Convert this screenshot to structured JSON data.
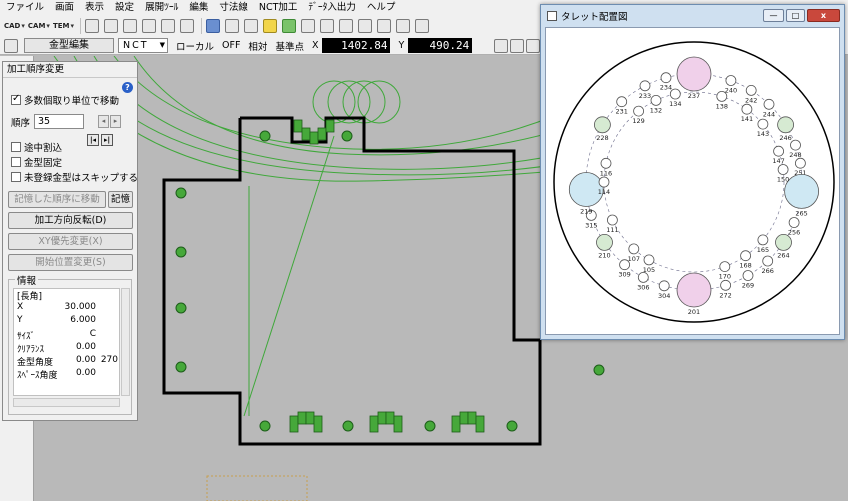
{
  "menubar": {
    "items": [
      "ファイル",
      "画面",
      "表示",
      "設定",
      "展開ﾂｰﾙ",
      "編集",
      "寸法線",
      "NCT加工",
      "ﾃﾞｰﾀ入出力",
      "ヘルプ"
    ]
  },
  "toolbar1": {
    "button_labels": [
      "CAD",
      "CAM",
      "TEM"
    ]
  },
  "toolbar2": {
    "mode_label": "金型編集",
    "mode_select": "NCT",
    "items": [
      "ローカル",
      "OFF",
      "相対",
      "基準点"
    ],
    "x_label": "X",
    "x_value": "1402.84",
    "y_label": "Y",
    "y_value": "490.24"
  },
  "order_panel": {
    "title": "加工順序変更",
    "multi_move": {
      "label": "多数個取り単位で移動",
      "checked": true
    },
    "order_label": "順序",
    "order_value": "35",
    "interrupt": {
      "label": "途中割込",
      "checked": false
    },
    "die_fixed": {
      "label": "金型固定",
      "checked": false
    },
    "skip_unregistered": {
      "label": "未登録金型はスキップする",
      "checked": false
    },
    "move_to_memory_button": "記憶した順序に移動",
    "memory_button": "記憶",
    "reverse_button": "加工方向反転(D)",
    "xy_priority_button": "XY優先変更(X)",
    "start_pos_button": "開始位置変更(S)",
    "info_group_label": "情報",
    "info_rows": [
      {
        "k": "[長角]",
        "v": "",
        "e": ""
      },
      {
        "k": "X",
        "v": "30.000",
        "e": ""
      },
      {
        "k": "Y",
        "v": "6.000",
        "e": ""
      },
      {
        "k": "ｻｲｽﾞ",
        "v": "C",
        "e": ""
      },
      {
        "k": "ｸﾘｱﾗﾝｽ",
        "v": "0.00",
        "e": ""
      },
      {
        "k": "金型角度",
        "v": "0.00",
        "e": "270"
      },
      {
        "k": "ｽﾍﾟｰｽ角度",
        "v": "0.00",
        "e": ""
      }
    ]
  },
  "turret_window": {
    "title": "タレット配置図",
    "stations": [
      {
        "id": "237",
        "ring": "outer",
        "angle": 0,
        "size": "large",
        "fill": "#f0d0ea"
      },
      {
        "id": "240",
        "ring": "outer",
        "angle": 20,
        "size": "small",
        "fill": "#ffffff"
      },
      {
        "id": "242",
        "ring": "outer",
        "angle": 32,
        "size": "small",
        "fill": "#ffffff"
      },
      {
        "id": "244",
        "ring": "outer",
        "angle": 44,
        "size": "small",
        "fill": "#ffffff"
      },
      {
        "id": "246",
        "ring": "outer",
        "angle": 58,
        "size": "medium",
        "fill": "#d6ead2"
      },
      {
        "id": "248",
        "ring": "outer",
        "angle": 70,
        "size": "small",
        "fill": "#ffffff"
      },
      {
        "id": "251",
        "ring": "outer",
        "angle": 80,
        "size": "small",
        "fill": "#ffffff"
      },
      {
        "id": "265",
        "ring": "outer",
        "angle": 95,
        "size": "large",
        "fill": "#cfe8f3"
      },
      {
        "id": "256",
        "ring": "outer",
        "angle": 112,
        "size": "small",
        "fill": "#ffffff"
      },
      {
        "id": "264",
        "ring": "outer",
        "angle": 124,
        "size": "medium",
        "fill": "#d6ead2"
      },
      {
        "id": "266",
        "ring": "outer",
        "angle": 137,
        "size": "small",
        "fill": "#ffffff"
      },
      {
        "id": "269",
        "ring": "outer",
        "angle": 150,
        "size": "small",
        "fill": "#ffffff"
      },
      {
        "id": "272",
        "ring": "outer",
        "angle": 163,
        "size": "small",
        "fill": "#ffffff"
      },
      {
        "id": "201",
        "ring": "outer",
        "angle": 180,
        "size": "large",
        "fill": "#f0d0ea"
      },
      {
        "id": "304",
        "ring": "outer",
        "angle": 196,
        "size": "small",
        "fill": "#ffffff"
      },
      {
        "id": "306",
        "ring": "outer",
        "angle": 208,
        "size": "small",
        "fill": "#ffffff"
      },
      {
        "id": "309",
        "ring": "outer",
        "angle": 220,
        "size": "small",
        "fill": "#ffffff"
      },
      {
        "id": "210",
        "ring": "outer",
        "angle": 236,
        "size": "medium",
        "fill": "#d6ead2"
      },
      {
        "id": "315",
        "ring": "outer",
        "angle": 252,
        "size": "small",
        "fill": "#ffffff"
      },
      {
        "id": "219",
        "ring": "outer",
        "angle": 266,
        "size": "large",
        "fill": "#cfe8f3"
      },
      {
        "id": "228",
        "ring": "outer",
        "angle": 302,
        "size": "medium",
        "fill": "#d6ead2"
      },
      {
        "id": "231",
        "ring": "outer",
        "angle": 318,
        "size": "small",
        "fill": "#ffffff"
      },
      {
        "id": "233",
        "ring": "outer",
        "angle": 333,
        "size": "small",
        "fill": "#ffffff"
      },
      {
        "id": "234",
        "ring": "outer",
        "angle": 345,
        "size": "small",
        "fill": "#ffffff"
      },
      {
        "id": "138",
        "ring": "inner",
        "angle": 18,
        "size": "small",
        "fill": "#ffffff"
      },
      {
        "id": "141",
        "ring": "inner",
        "angle": 36,
        "size": "small",
        "fill": "#ffffff"
      },
      {
        "id": "143",
        "ring": "inner",
        "angle": 50,
        "size": "small",
        "fill": "#ffffff"
      },
      {
        "id": "147",
        "ring": "inner",
        "angle": 70,
        "size": "small",
        "fill": "#ffffff"
      },
      {
        "id": "150",
        "ring": "inner",
        "angle": 82,
        "size": "small",
        "fill": "#ffffff"
      },
      {
        "id": "165",
        "ring": "inner",
        "angle": 130,
        "size": "small",
        "fill": "#ffffff"
      },
      {
        "id": "168",
        "ring": "inner",
        "angle": 145,
        "size": "small",
        "fill": "#ffffff"
      },
      {
        "id": "170",
        "ring": "inner",
        "angle": 160,
        "size": "small",
        "fill": "#ffffff"
      },
      {
        "id": "105",
        "ring": "inner",
        "angle": 210,
        "size": "small",
        "fill": "#ffffff"
      },
      {
        "id": "107",
        "ring": "inner",
        "angle": 222,
        "size": "small",
        "fill": "#ffffff"
      },
      {
        "id": "111",
        "ring": "inner",
        "angle": 245,
        "size": "small",
        "fill": "#ffffff"
      },
      {
        "id": "114",
        "ring": "inner",
        "angle": 270,
        "size": "small",
        "fill": "#ffffff"
      },
      {
        "id": "116",
        "ring": "inner",
        "angle": 282,
        "size": "small",
        "fill": "#ffffff"
      },
      {
        "id": "129",
        "ring": "inner",
        "angle": 322,
        "size": "small",
        "fill": "#ffffff"
      },
      {
        "id": "132",
        "ring": "inner",
        "angle": 335,
        "size": "small",
        "fill": "#ffffff"
      },
      {
        "id": "134",
        "ring": "inner",
        "angle": 348,
        "size": "small",
        "fill": "#ffffff"
      }
    ]
  },
  "colors": {
    "path": "#3fa83a",
    "part_outline": "#000000",
    "punch_fill": "#46a83a",
    "canvas_bg": "#b9b9b9"
  }
}
